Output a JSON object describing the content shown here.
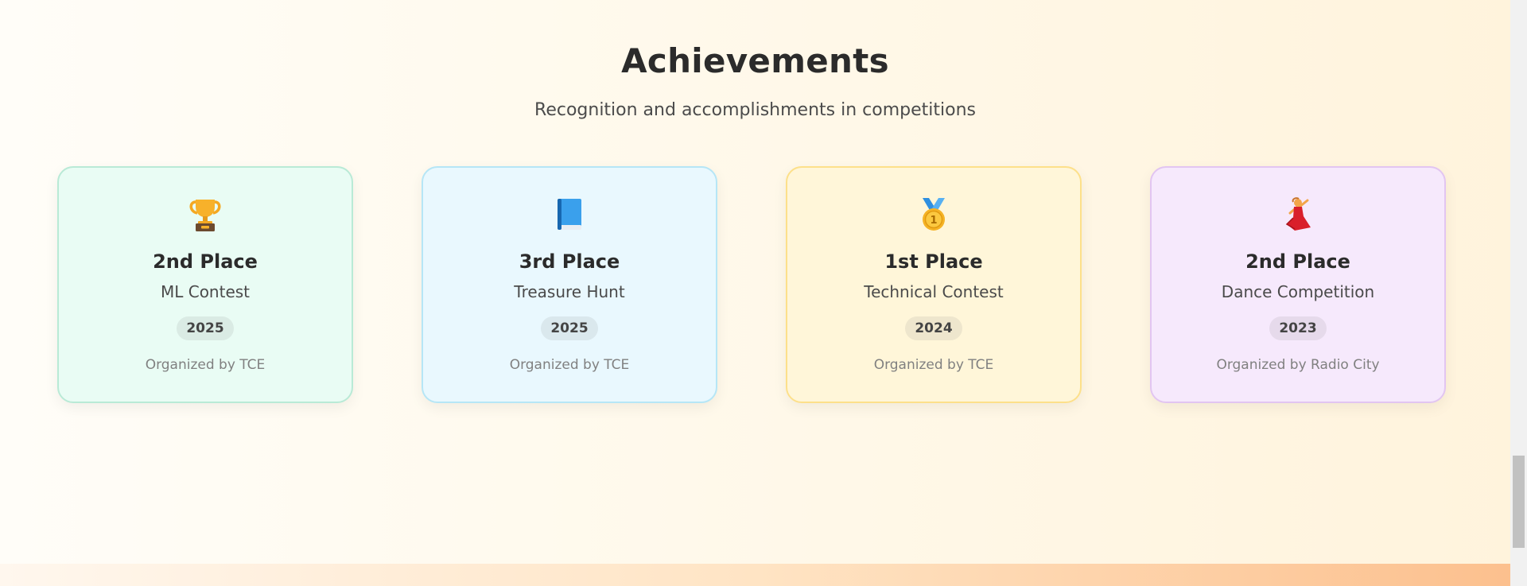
{
  "section": {
    "title": "Achievements",
    "subtitle": "Recognition and accomplishments in competitions"
  },
  "cards": [
    {
      "icon": "trophy-icon",
      "place": "2nd Place",
      "event": "ML Contest",
      "year": "2025",
      "org": "Organized by TCE",
      "bg": "#e9fcf4",
      "border": "#b9ead6"
    },
    {
      "icon": "blue-book-icon",
      "place": "3rd Place",
      "event": "Treasure Hunt",
      "year": "2025",
      "org": "Organized by TCE",
      "bg": "#e9f8fe",
      "border": "#b6e6f6"
    },
    {
      "icon": "first-place-medal-icon",
      "place": "1st Place",
      "event": "Technical Contest",
      "year": "2024",
      "org": "Organized by TCE",
      "bg": "#fff6d9",
      "border": "#fde08a"
    },
    {
      "icon": "dancer-icon",
      "place": "2nd Place",
      "event": "Dance Competition",
      "year": "2023",
      "org": "Organized by Radio City",
      "bg": "#f6e9fc",
      "border": "#e2c5f1"
    }
  ]
}
